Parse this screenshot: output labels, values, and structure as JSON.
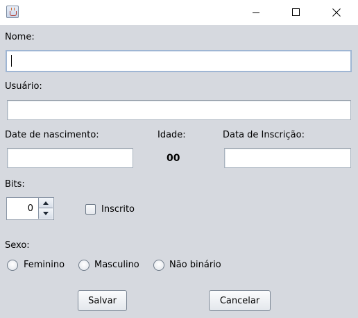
{
  "window": {
    "title": "",
    "icon": "java-coffee-icon",
    "controls": [
      "minimize-icon",
      "maximize-icon",
      "close-icon"
    ]
  },
  "form": {
    "nome": {
      "label": "Nome:",
      "value": ""
    },
    "usuario": {
      "label": "Usuário:",
      "value": ""
    },
    "data_nascimento": {
      "label": "Date de nascimento:",
      "value": ""
    },
    "idade": {
      "label": "Idade:",
      "value": "00"
    },
    "data_inscricao": {
      "label": "Data de Inscrição:",
      "value": ""
    },
    "bits": {
      "label": "Bits:",
      "value": "0"
    },
    "inscrito": {
      "label": "Inscrito",
      "checked": false
    },
    "sexo": {
      "label": "Sexo:",
      "options": [
        {
          "label": "Feminino",
          "selected": false
        },
        {
          "label": "Masculino",
          "selected": false
        },
        {
          "label": "Não binário",
          "selected": false
        }
      ]
    },
    "buttons": {
      "save": "Salvar",
      "cancel": "Cancelar"
    }
  },
  "colors": {
    "background": "#d6d9df",
    "titlebar": "#ffffff",
    "focus_border": "#9fb6d4"
  }
}
